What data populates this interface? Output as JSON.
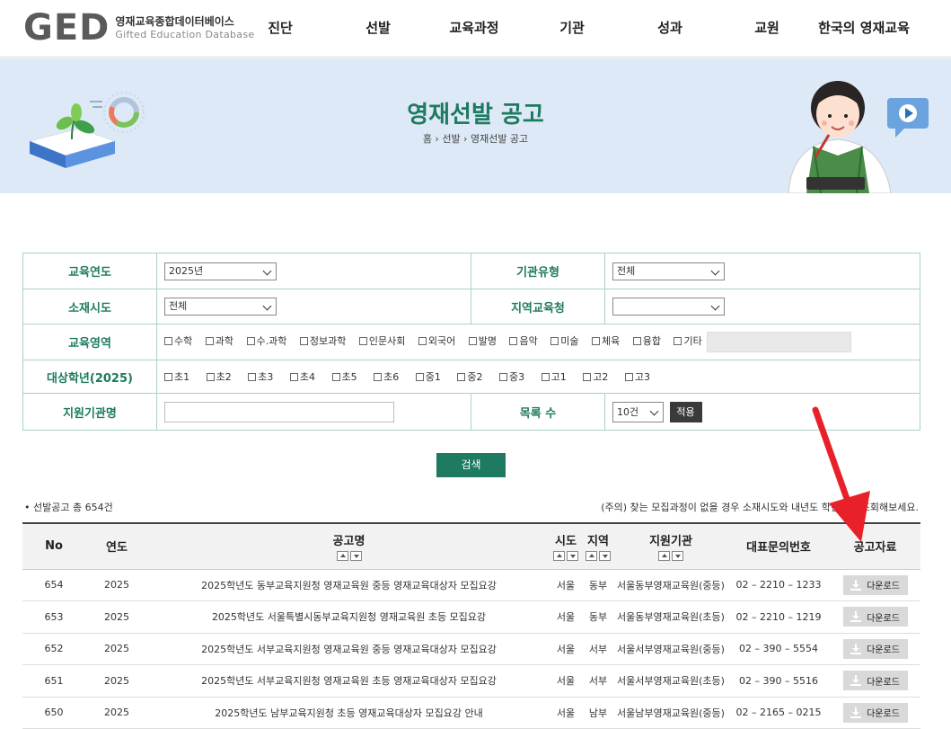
{
  "logo": {
    "mark": "GED",
    "korean": "영재교육종합데이터베이스",
    "english": "Gifted Education Database"
  },
  "nav": [
    "진단",
    "선발",
    "교육과정",
    "기관",
    "성과",
    "교원",
    "한국의 영재교육"
  ],
  "banner": {
    "title": "영재선발 공고",
    "breadcrumb": "홈 › 선발 › 영재선발 공고"
  },
  "filters": {
    "year_label": "교육연도",
    "year_value": "2025년",
    "inst_type_label": "기관유형",
    "inst_type_value": "전체",
    "region_label": "소재시도",
    "region_value": "전체",
    "office_label": "지역교육청",
    "office_value": "",
    "field_label": "교육영역",
    "fields": [
      "수학",
      "과학",
      "수.과학",
      "정보과학",
      "인문사회",
      "외국어",
      "발명",
      "음악",
      "미술",
      "체육",
      "융합",
      "기타"
    ],
    "grade_label": "대상학년(2025)",
    "grades": [
      "초1",
      "초2",
      "초3",
      "초4",
      "초5",
      "초6",
      "중1",
      "중2",
      "중3",
      "고1",
      "고2",
      "고3"
    ],
    "inst_name_label": "지원기관명",
    "inst_name_value": "",
    "page_size_label": "목록 수",
    "page_size_value": "10건",
    "apply_label": "적용"
  },
  "search_label": "검색",
  "result_count": "선발공고 총 654건",
  "notice": "(주의) 찾는 모집과정이 없을 경우 소재시도와 내년도 학년으로 조회해보세요.",
  "table": {
    "headers": {
      "no": "No",
      "year": "연도",
      "title": "공고명",
      "city": "시도",
      "area": "지역",
      "org": "지원기관",
      "phone": "대표문의번호",
      "file": "공고자료"
    },
    "download_label": "다운로드",
    "rows": [
      {
        "no": "654",
        "year": "2025",
        "title": "2025학년도 동부교육지원청 영재교육원 중등 영재교육대상자 모집요강",
        "city": "서울",
        "area": "동부",
        "org": "서울동부영재교육원(중등)",
        "phone": "02 – 2210 – 1233"
      },
      {
        "no": "653",
        "year": "2025",
        "title": "2025학년도 서울특별시동부교육지원청 영재교육원 초등 모집요강",
        "city": "서울",
        "area": "동부",
        "org": "서울동부영재교육원(초등)",
        "phone": "02 – 2210 – 1219"
      },
      {
        "no": "652",
        "year": "2025",
        "title": "2025학년도 서부교육지원청 영재교육원 중등 영재교육대상자 모집요강",
        "city": "서울",
        "area": "서부",
        "org": "서울서부영재교육원(중등)",
        "phone": "02 – 390 – 5554"
      },
      {
        "no": "651",
        "year": "2025",
        "title": "2025학년도 서부교육지원청 영재교육원 초등 영재교육대상자 모집요강",
        "city": "서울",
        "area": "서부",
        "org": "서울서부영재교육원(초등)",
        "phone": "02 – 390 – 5516"
      },
      {
        "no": "650",
        "year": "2025",
        "title": "2025학년도 남부교육지원청 초등 영재교육대상자 모집요강 안내",
        "city": "서울",
        "area": "남부",
        "org": "서울남부영재교육원(중등)",
        "phone": "02 – 2165 – 0215"
      }
    ]
  },
  "colors": {
    "brand": "#1e7a60",
    "banner_bg": "#dde9f7",
    "annotation_arrow": "#e8202a"
  }
}
